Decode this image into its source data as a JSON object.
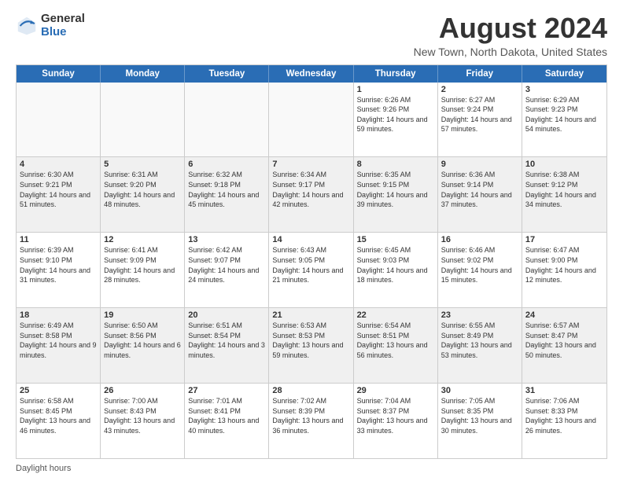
{
  "header": {
    "logo_general": "General",
    "logo_blue": "Blue",
    "main_title": "August 2024",
    "subtitle": "New Town, North Dakota, United States"
  },
  "calendar": {
    "days_of_week": [
      "Sunday",
      "Monday",
      "Tuesday",
      "Wednesday",
      "Thursday",
      "Friday",
      "Saturday"
    ],
    "weeks": [
      [
        {
          "day": "",
          "info": ""
        },
        {
          "day": "",
          "info": ""
        },
        {
          "day": "",
          "info": ""
        },
        {
          "day": "",
          "info": ""
        },
        {
          "day": "1",
          "info": "Sunrise: 6:26 AM\nSunset: 9:26 PM\nDaylight: 14 hours and 59 minutes."
        },
        {
          "day": "2",
          "info": "Sunrise: 6:27 AM\nSunset: 9:24 PM\nDaylight: 14 hours and 57 minutes."
        },
        {
          "day": "3",
          "info": "Sunrise: 6:29 AM\nSunset: 9:23 PM\nDaylight: 14 hours and 54 minutes."
        }
      ],
      [
        {
          "day": "4",
          "info": "Sunrise: 6:30 AM\nSunset: 9:21 PM\nDaylight: 14 hours and 51 minutes."
        },
        {
          "day": "5",
          "info": "Sunrise: 6:31 AM\nSunset: 9:20 PM\nDaylight: 14 hours and 48 minutes."
        },
        {
          "day": "6",
          "info": "Sunrise: 6:32 AM\nSunset: 9:18 PM\nDaylight: 14 hours and 45 minutes."
        },
        {
          "day": "7",
          "info": "Sunrise: 6:34 AM\nSunset: 9:17 PM\nDaylight: 14 hours and 42 minutes."
        },
        {
          "day": "8",
          "info": "Sunrise: 6:35 AM\nSunset: 9:15 PM\nDaylight: 14 hours and 39 minutes."
        },
        {
          "day": "9",
          "info": "Sunrise: 6:36 AM\nSunset: 9:14 PM\nDaylight: 14 hours and 37 minutes."
        },
        {
          "day": "10",
          "info": "Sunrise: 6:38 AM\nSunset: 9:12 PM\nDaylight: 14 hours and 34 minutes."
        }
      ],
      [
        {
          "day": "11",
          "info": "Sunrise: 6:39 AM\nSunset: 9:10 PM\nDaylight: 14 hours and 31 minutes."
        },
        {
          "day": "12",
          "info": "Sunrise: 6:41 AM\nSunset: 9:09 PM\nDaylight: 14 hours and 28 minutes."
        },
        {
          "day": "13",
          "info": "Sunrise: 6:42 AM\nSunset: 9:07 PM\nDaylight: 14 hours and 24 minutes."
        },
        {
          "day": "14",
          "info": "Sunrise: 6:43 AM\nSunset: 9:05 PM\nDaylight: 14 hours and 21 minutes."
        },
        {
          "day": "15",
          "info": "Sunrise: 6:45 AM\nSunset: 9:03 PM\nDaylight: 14 hours and 18 minutes."
        },
        {
          "day": "16",
          "info": "Sunrise: 6:46 AM\nSunset: 9:02 PM\nDaylight: 14 hours and 15 minutes."
        },
        {
          "day": "17",
          "info": "Sunrise: 6:47 AM\nSunset: 9:00 PM\nDaylight: 14 hours and 12 minutes."
        }
      ],
      [
        {
          "day": "18",
          "info": "Sunrise: 6:49 AM\nSunset: 8:58 PM\nDaylight: 14 hours and 9 minutes."
        },
        {
          "day": "19",
          "info": "Sunrise: 6:50 AM\nSunset: 8:56 PM\nDaylight: 14 hours and 6 minutes."
        },
        {
          "day": "20",
          "info": "Sunrise: 6:51 AM\nSunset: 8:54 PM\nDaylight: 14 hours and 3 minutes."
        },
        {
          "day": "21",
          "info": "Sunrise: 6:53 AM\nSunset: 8:53 PM\nDaylight: 13 hours and 59 minutes."
        },
        {
          "day": "22",
          "info": "Sunrise: 6:54 AM\nSunset: 8:51 PM\nDaylight: 13 hours and 56 minutes."
        },
        {
          "day": "23",
          "info": "Sunrise: 6:55 AM\nSunset: 8:49 PM\nDaylight: 13 hours and 53 minutes."
        },
        {
          "day": "24",
          "info": "Sunrise: 6:57 AM\nSunset: 8:47 PM\nDaylight: 13 hours and 50 minutes."
        }
      ],
      [
        {
          "day": "25",
          "info": "Sunrise: 6:58 AM\nSunset: 8:45 PM\nDaylight: 13 hours and 46 minutes."
        },
        {
          "day": "26",
          "info": "Sunrise: 7:00 AM\nSunset: 8:43 PM\nDaylight: 13 hours and 43 minutes."
        },
        {
          "day": "27",
          "info": "Sunrise: 7:01 AM\nSunset: 8:41 PM\nDaylight: 13 hours and 40 minutes."
        },
        {
          "day": "28",
          "info": "Sunrise: 7:02 AM\nSunset: 8:39 PM\nDaylight: 13 hours and 36 minutes."
        },
        {
          "day": "29",
          "info": "Sunrise: 7:04 AM\nSunset: 8:37 PM\nDaylight: 13 hours and 33 minutes."
        },
        {
          "day": "30",
          "info": "Sunrise: 7:05 AM\nSunset: 8:35 PM\nDaylight: 13 hours and 30 minutes."
        },
        {
          "day": "31",
          "info": "Sunrise: 7:06 AM\nSunset: 8:33 PM\nDaylight: 13 hours and 26 minutes."
        }
      ]
    ]
  },
  "footer": {
    "text": "Daylight hours"
  }
}
